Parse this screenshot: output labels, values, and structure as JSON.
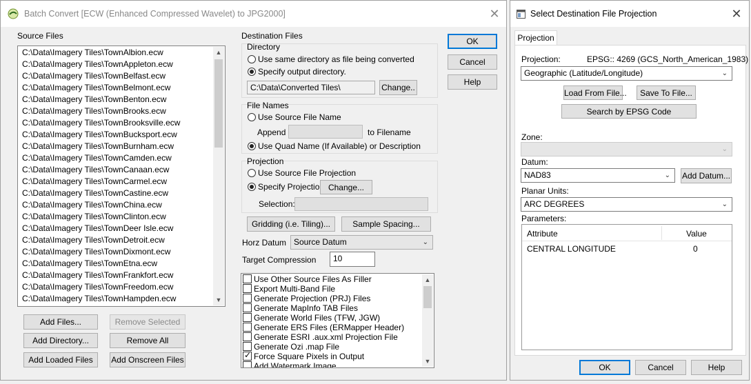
{
  "batch": {
    "title": "Batch Convert [ECW (Enhanced Compressed Wavelet) to JPG2000]",
    "close": "✕",
    "source_files_label": "Source Files",
    "files": [
      "C:\\Data\\Imagery Tiles\\TownAlbion.ecw",
      "C:\\Data\\Imagery Tiles\\TownAppleton.ecw",
      "C:\\Data\\Imagery Tiles\\TownBelfast.ecw",
      "C:\\Data\\Imagery Tiles\\TownBelmont.ecw",
      "C:\\Data\\Imagery Tiles\\TownBenton.ecw",
      "C:\\Data\\Imagery Tiles\\TownBrooks.ecw",
      "C:\\Data\\Imagery Tiles\\TownBrooksville.ecw",
      "C:\\Data\\Imagery Tiles\\TownBucksport.ecw",
      "C:\\Data\\Imagery Tiles\\TownBurnham.ecw",
      "C:\\Data\\Imagery Tiles\\TownCamden.ecw",
      "C:\\Data\\Imagery Tiles\\TownCanaan.ecw",
      "C:\\Data\\Imagery Tiles\\TownCarmel.ecw",
      "C:\\Data\\Imagery Tiles\\TownCastine.ecw",
      "C:\\Data\\Imagery Tiles\\TownChina.ecw",
      "C:\\Data\\Imagery Tiles\\TownClinton.ecw",
      "C:\\Data\\Imagery Tiles\\TownDeer Isle.ecw",
      "C:\\Data\\Imagery Tiles\\TownDetroit.ecw",
      "C:\\Data\\Imagery Tiles\\TownDixmont.ecw",
      "C:\\Data\\Imagery Tiles\\TownEtna.ecw",
      "C:\\Data\\Imagery Tiles\\TownFrankfort.ecw",
      "C:\\Data\\Imagery Tiles\\TownFreedom.ecw",
      "C:\\Data\\Imagery Tiles\\TownHampden.ecw"
    ],
    "add_files": "Add Files...",
    "remove_selected": "Remove Selected",
    "add_directory": "Add Directory...",
    "remove_all": "Remove All",
    "add_loaded_files": "Add Loaded Files",
    "add_onscreen_files": "Add Onscreen Files",
    "destination_files_label": "Destination Files",
    "directory_label": "Directory",
    "same_directory": "Use same directory as file being converted",
    "specify_output": "Specify output directory.",
    "output_dir": "C:\\Data\\Converted Tiles\\",
    "change_dir": "Change..",
    "file_names_label": "File Names",
    "use_source_name": "Use Source File Name",
    "append_label": "Append",
    "append_value": "",
    "to_filename": "to Filename",
    "use_quad_name": "Use Quad Name (If Available) or Description",
    "projection_label": "Projection",
    "use_source_projection": "Use Source File Projection",
    "specify_projection": "Specify Projection",
    "change_projection": "Change...",
    "selection_label": "Selection:",
    "selection_value": "",
    "gridding": "Gridding (i.e. Tiling)...",
    "sample_spacing": "Sample Spacing...",
    "horz_datum_label": "Horz Datum",
    "horz_datum_value": "Source Datum",
    "target_compression_label": "Target Compression",
    "target_compression_value": "10",
    "options": [
      {
        "label": "Use Other Source Files As Filler",
        "checked": false
      },
      {
        "label": "Export Multi-Band File",
        "checked": false
      },
      {
        "label": "Generate Projection (PRJ) Files",
        "checked": false
      },
      {
        "label": "Generate MapInfo TAB Files",
        "checked": false
      },
      {
        "label": "Generate World Files (TFW, JGW)",
        "checked": false
      },
      {
        "label": "Generate ERS Files (ERMapper Header)",
        "checked": false
      },
      {
        "label": "Generate ESRI .aux.xml Projection File",
        "checked": false
      },
      {
        "label": "Generate Ozi .map File",
        "checked": false
      },
      {
        "label": "Force Square Pixels in Output",
        "checked": true
      },
      {
        "label": "Add Watermark Image",
        "checked": false
      }
    ],
    "ok": "OK",
    "cancel": "Cancel",
    "help": "Help"
  },
  "proj": {
    "title": "Select Destination File Projection",
    "close": "✕",
    "tab": "Projection",
    "projection_label": "Projection:",
    "projection_code": "EPSG:: 4269 (GCS_North_American_1983)",
    "projection_value": "Geographic (Latitude/Longitude)",
    "load_from_file": "Load From File...",
    "save_to_file": "Save To File...",
    "search_epsg": "Search by EPSG Code",
    "zone_label": "Zone:",
    "zone_value": "",
    "datum_label": "Datum:",
    "datum_value": "NAD83",
    "add_datum": "Add Datum...",
    "planar_units_label": "Planar Units:",
    "planar_units_value": "ARC DEGREES",
    "parameters_label": "Parameters:",
    "param_headers": {
      "attribute": "Attribute",
      "value": "Value"
    },
    "params": [
      {
        "attribute": "CENTRAL LONGITUDE",
        "value": "0"
      }
    ],
    "ok": "OK",
    "cancel": "Cancel",
    "help": "Help"
  }
}
